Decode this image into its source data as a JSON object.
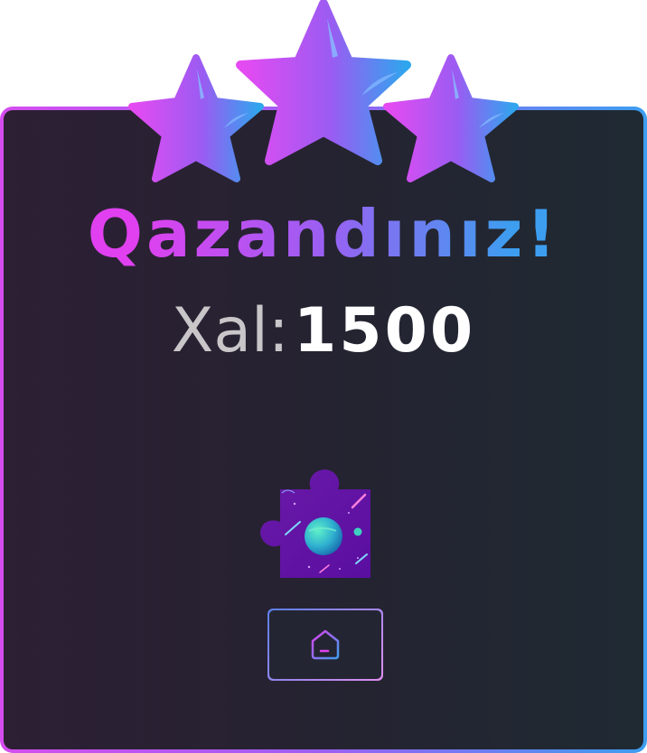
{
  "result": {
    "title": "Qazandınız!",
    "score_label": "Xal:",
    "score_value": "1500",
    "stars_earned": 3,
    "stars_total": 3
  },
  "puzzle_piece": {
    "icon": "space-planet-puzzle-piece-icon"
  },
  "home_button": {
    "icon": "home-icon"
  },
  "colors": {
    "gradient_start": "#e040f0",
    "gradient_mid": "#9b5ff2",
    "gradient_end": "#3d9ef0",
    "card_bg": "#252331",
    "score_label": "#c8c6c8",
    "score_value": "#ffffff"
  }
}
